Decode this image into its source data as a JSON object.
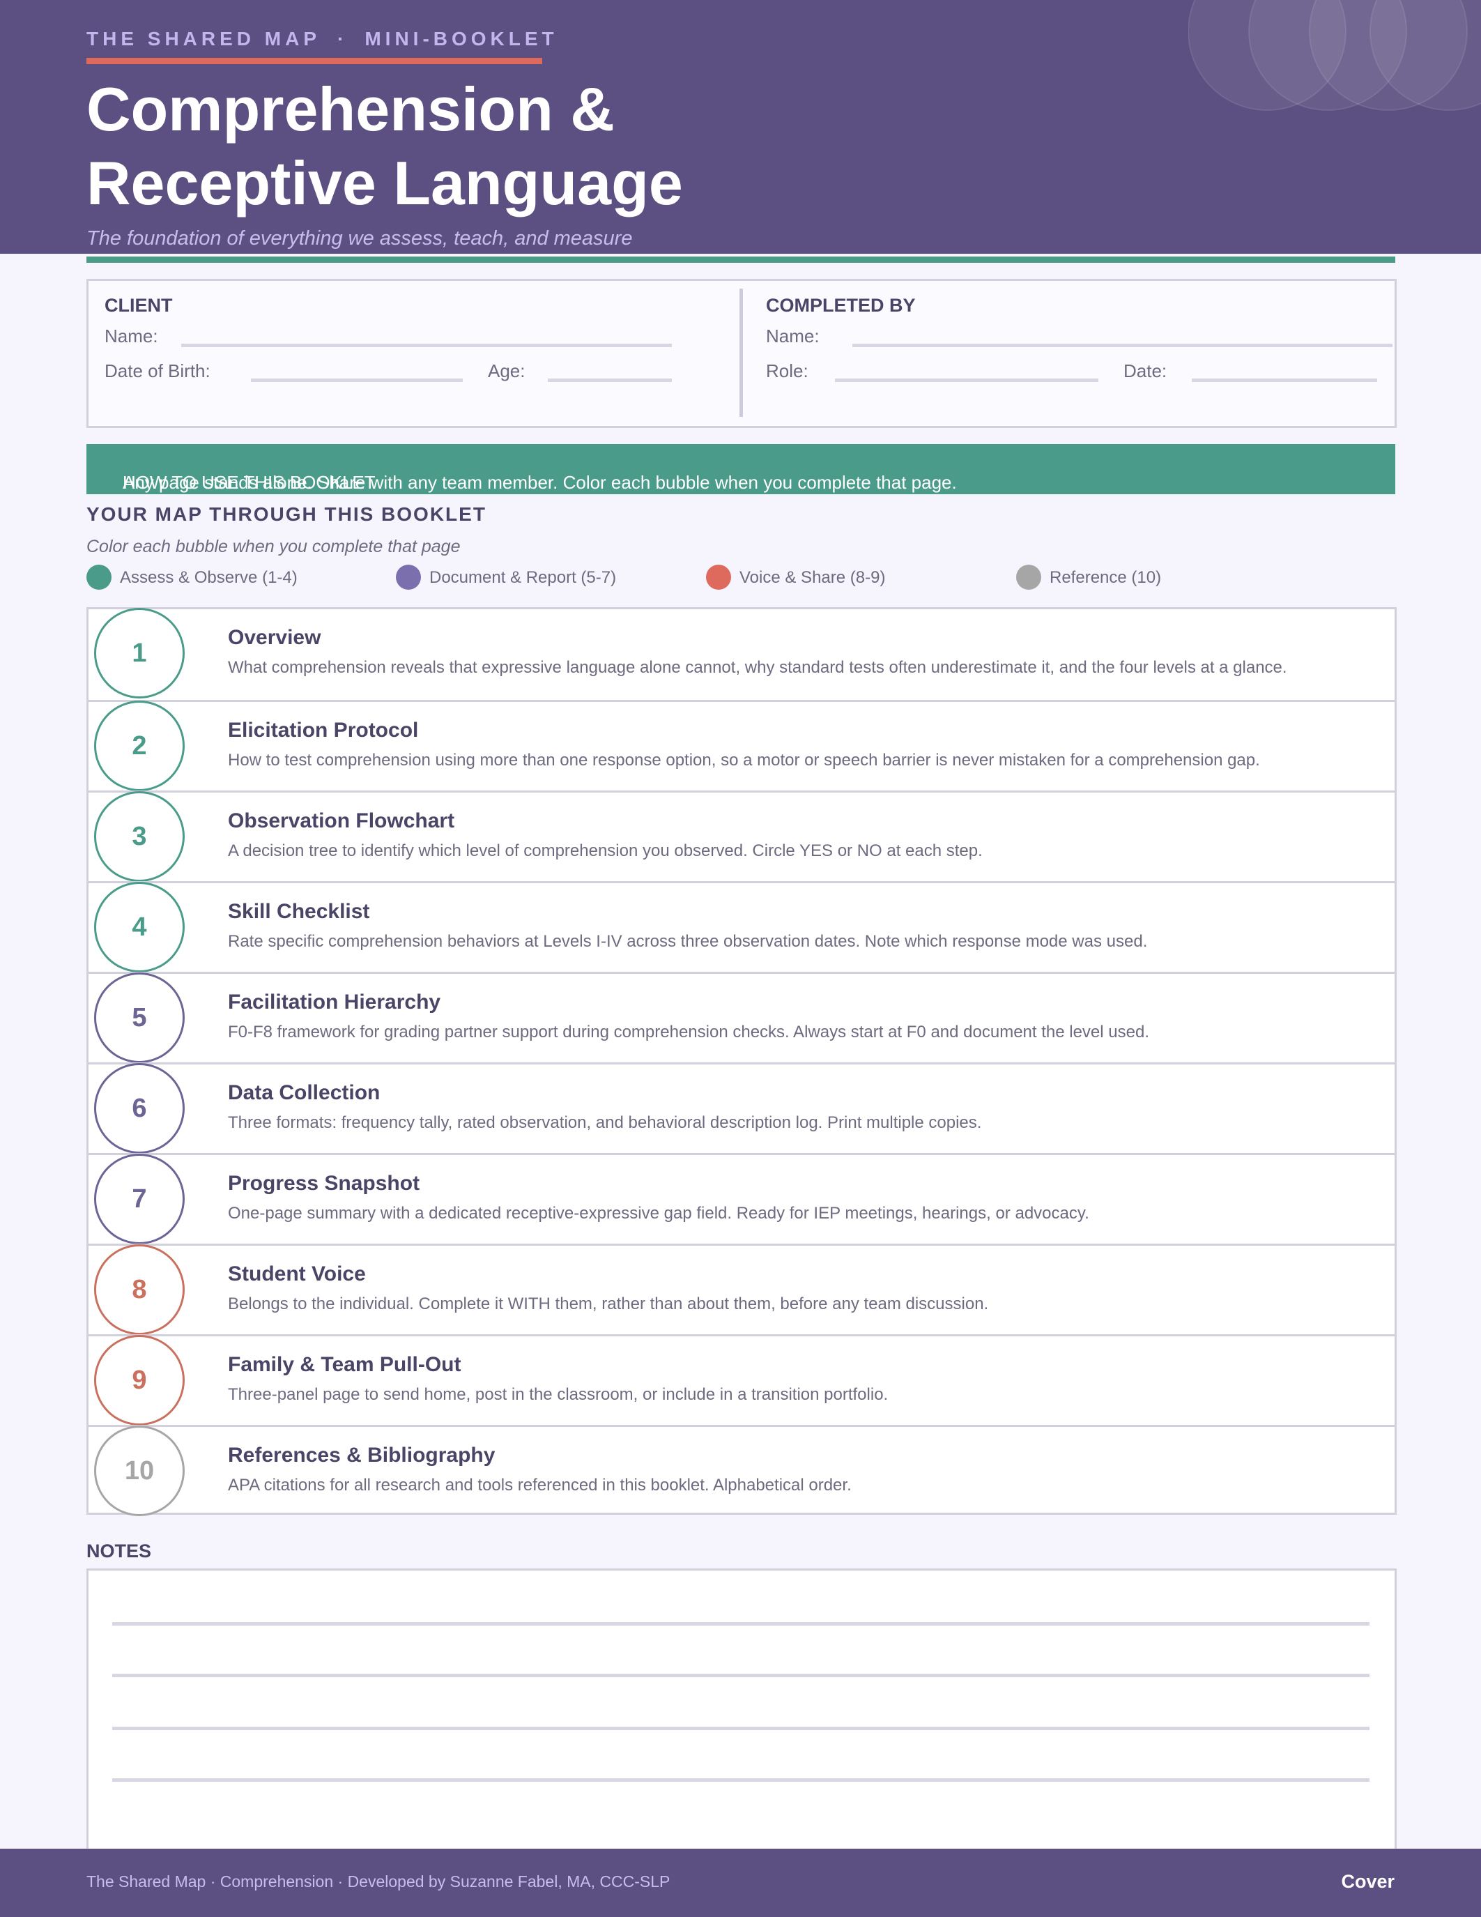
{
  "header": {
    "kicker_left": "THE SHARED MAP",
    "kicker_sep": "·",
    "kicker_right": "MINI-BOOKLET",
    "title_line1": "Comprehension &",
    "title_line2": "Receptive Language",
    "subtitle": "The foundation of everything we assess, teach, and measure"
  },
  "client": {
    "heading": "CLIENT",
    "name_label": "Name:",
    "dob_label": "Date of Birth:",
    "age_label": "Age:"
  },
  "completed_by": {
    "heading": "COMPLETED BY",
    "name_label": "Name:",
    "role_label": "Role:",
    "date_label": "Date:"
  },
  "how_to": {
    "label": "HOW TO USE THIS BOOKLET",
    "text": "Any page stands alone. Share with any team member. Color each bubble when you complete that page."
  },
  "map": {
    "title": "YOUR MAP THROUGH THIS BOOKLET",
    "subtitle": "Color each bubble when you complete that page",
    "legend": [
      {
        "label": "Assess & Observe  (1-4)",
        "color": "#4a9b89"
      },
      {
        "label": "Document & Report  (5-7)",
        "color": "#7b6fae"
      },
      {
        "label": "Voice & Share  (8-9)",
        "color": "#de6a5e"
      },
      {
        "label": "Reference  (10)",
        "color": "#a6a6a6"
      }
    ],
    "pages": [
      {
        "num": "1",
        "title": "Overview",
        "desc": "What comprehension reveals that expressive language alone cannot, why standard tests often underestimate it, and the four levels at a glance.",
        "color": "#4a9b89"
      },
      {
        "num": "2",
        "title": "Elicitation Protocol",
        "desc": "How to test comprehension using more than one response option, so a motor or speech barrier is never mistaken for a comprehension gap.",
        "color": "#4a9b89"
      },
      {
        "num": "3",
        "title": "Observation Flowchart",
        "desc": "A decision tree to identify which level of comprehension you observed. Circle YES or NO at each step.",
        "color": "#4a9b89"
      },
      {
        "num": "4",
        "title": "Skill Checklist",
        "desc": "Rate specific comprehension behaviors at Levels I-IV across three observation dates. Note which response mode was used.",
        "color": "#4a9b89"
      },
      {
        "num": "5",
        "title": "Facilitation Hierarchy",
        "desc": "F0-F8 framework for grading partner support during comprehension checks. Always start at F0 and document the level used.",
        "color": "#6c6494"
      },
      {
        "num": "6",
        "title": "Data Collection",
        "desc": "Three formats: frequency tally, rated observation, and behavioral description log. Print multiple copies.",
        "color": "#6c6494"
      },
      {
        "num": "7",
        "title": "Progress Snapshot",
        "desc": "One-page summary with a dedicated receptive-expressive gap field. Ready for IEP meetings, hearings, or advocacy.",
        "color": "#6c6494"
      },
      {
        "num": "8",
        "title": "Student Voice",
        "desc": "Belongs to the individual. Complete it WITH them, rather than about them, before any team discussion.",
        "color": "#c9705e"
      },
      {
        "num": "9",
        "title": "Family & Team Pull-Out",
        "desc": "Three-panel page to send home, post in the classroom, or include in a transition portfolio.",
        "color": "#c9705e"
      },
      {
        "num": "10",
        "title": "References & Bibliography",
        "desc": "APA citations for all research and tools referenced in this booklet. Alphabetical order.",
        "color": "#a6a6a6"
      }
    ]
  },
  "notes": {
    "title": "NOTES"
  },
  "footer": {
    "left": "The Shared Map · Comprehension · Developed by Suzanne Fabel, MA, CCC-SLP",
    "right": "Cover"
  }
}
